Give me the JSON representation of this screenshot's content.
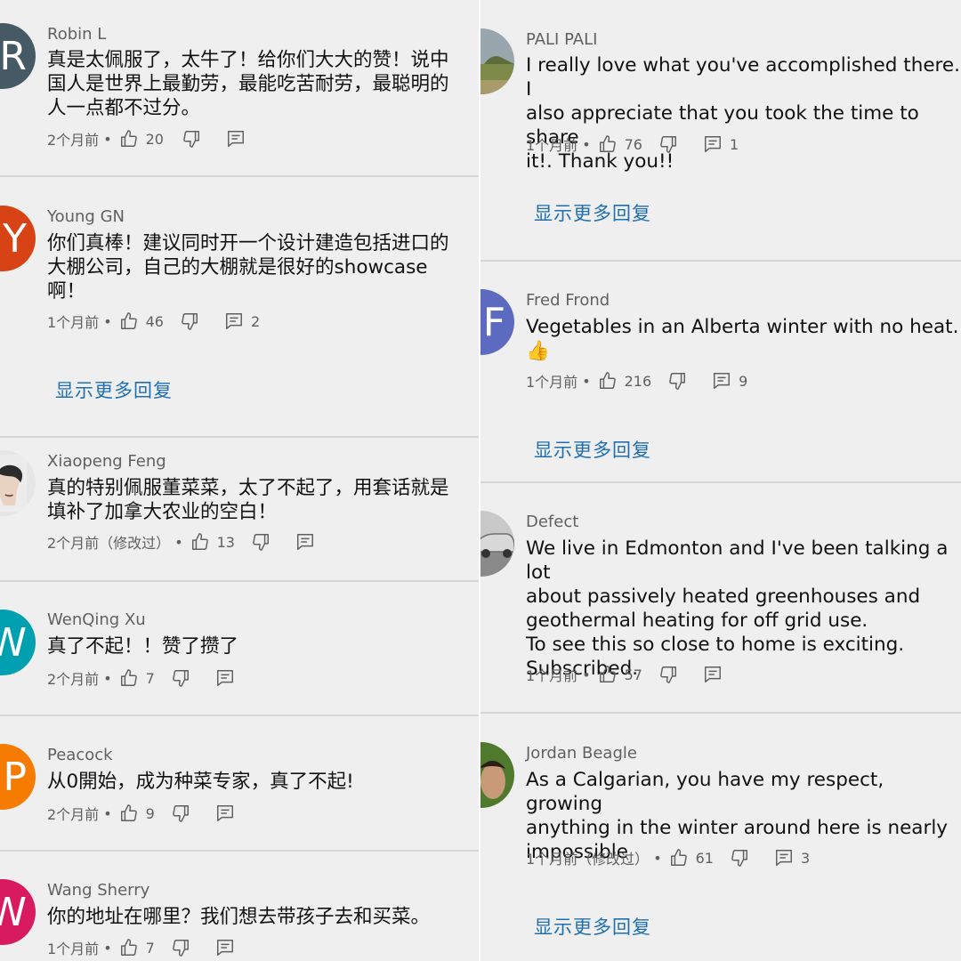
{
  "more_replies_label": "显示更多回复",
  "left": [
    {
      "author": "Robin L",
      "avatar_letter": "R",
      "avatar_color": "#455a64",
      "text": "真是太佩服了，太牛了！给你们大大的赞！说中\n国人是世界上最勤劳，最能吃苦耐劳，最聪明的\n人一点都不过分。",
      "time": "2个月前",
      "likes": "20",
      "replies": ""
    },
    {
      "author": "Young GN",
      "avatar_letter": "Y",
      "avatar_color": "#d84315",
      "text": "你们真棒！建议同时开一个设计建造包括进口的\n大棚公司，自己的大棚就是很好的showcase\n啊！",
      "time": "1个月前",
      "likes": "46",
      "replies": "2",
      "more": true
    },
    {
      "author": "Xiaopeng Feng",
      "avatar_letter": "",
      "avatar_color": "#e0e0e0",
      "text": "真的特别佩服董菜菜，太了不起了，用套话就是\n填补了加拿大农业的空白！",
      "time": "2个月前（修改过）",
      "likes": "13",
      "replies": ""
    },
    {
      "author": "WenQing Xu",
      "avatar_letter": "W",
      "avatar_color": "#00a0b0",
      "text": "真了不起！！赞了攒了",
      "time": "2个月前",
      "likes": "7",
      "replies": ""
    },
    {
      "author": "Peacock",
      "avatar_letter": "P",
      "avatar_color": "#f57c00",
      "text": "从0開始，成为种菜专家，真了不起!",
      "time": "2个月前",
      "likes": "9",
      "replies": ""
    },
    {
      "author": "Wang Sherry",
      "avatar_letter": "W",
      "avatar_color": "#d81b60",
      "text": "你的地址在哪里？我们想去带孩子去和买菜。",
      "time": "1个月前",
      "likes": "7",
      "replies": ""
    }
  ],
  "right": [
    {
      "author": "PALI PALI",
      "avatar_letter": "",
      "avatar_color": "#8d8f6e",
      "text": "I really love what you've accomplished there. I\nalso appreciate that you took the time to share\nit!. Thank you!!",
      "time": "1个月前",
      "likes": "76",
      "replies": "1",
      "more": true
    },
    {
      "author": "Fred Frond",
      "avatar_letter": "F",
      "avatar_color": "#5c6bc0",
      "text": "Vegetables in an Alberta winter with no heat.\n👍",
      "time": "1个月前",
      "likes": "216",
      "replies": "9",
      "more": true
    },
    {
      "author": "Defect",
      "avatar_letter": "",
      "avatar_color": "#9e9e9e",
      "text": "We live in Edmonton and I've been talking a lot\nabout passively heated greenhouses and\ngeothermal heating for off grid use.\nTo see this so close to home is exciting.\nSubscribed.",
      "time": "1个月前",
      "likes": "57",
      "replies": ""
    },
    {
      "author": "Jordan Beagle",
      "avatar_letter": "",
      "avatar_color": "#5d7f3a",
      "text": "As a Calgarian, you have my respect, growing\nanything in the winter around here is nearly\nimpossible",
      "time": "1个月前（修改过）",
      "likes": "61",
      "replies": "3",
      "more": true
    }
  ]
}
